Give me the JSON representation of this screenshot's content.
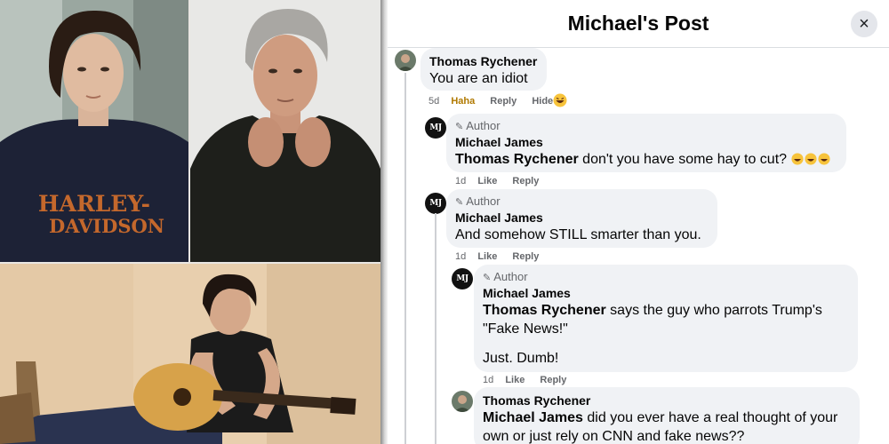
{
  "post": {
    "title": "Michael's Post",
    "close_icon": "×"
  },
  "photos": [
    {
      "name": "young-man-harley-sweater",
      "caption_text": "HARLEY-DAVIDSON"
    },
    {
      "name": "older-man-gray-hair"
    },
    {
      "name": "man-with-acoustic-guitar"
    }
  ],
  "comments": [
    {
      "author": "Thomas Rychener",
      "author_badge": "",
      "text": "You are an idiot",
      "time": "5d",
      "actions": [
        "Haha",
        "Reply",
        "Hide"
      ],
      "reaction": "laughing-emoji"
    },
    {
      "author": "Michael James",
      "author_badge": "Author",
      "mention": "Thomas Rychener",
      "text": " don't you have some hay to cut?",
      "time": "1d",
      "actions": [
        "Like",
        "Reply"
      ]
    },
    {
      "author": "Michael James",
      "author_badge": "Author",
      "text": "And somehow STILL smarter than you.",
      "time": "1d",
      "actions": [
        "Like",
        "Reply"
      ]
    },
    {
      "author": "Michael James",
      "author_badge": "Author",
      "mention": "Thomas Rychener",
      "text": " says the guy who parrots Trump's \"Fake News!\"",
      "text2": "Just. Dumb!",
      "time": "1d",
      "actions": [
        "Like",
        "Reply"
      ]
    },
    {
      "author": "Thomas Rychener",
      "author_badge": "",
      "mention": "Michael James",
      "text": " did you ever have a real thought of your own or just rely on CNN and fake news??"
    }
  ],
  "colors": {
    "bubble": "#f0f2f5",
    "meta": "#65676b",
    "haha": "#b07900"
  }
}
